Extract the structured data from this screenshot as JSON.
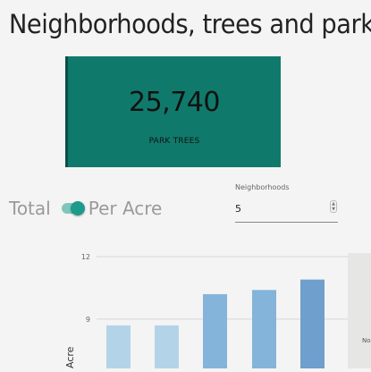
{
  "page": {
    "title": "Neighborhoods, trees and parks"
  },
  "kpi": {
    "value": "25,740",
    "label": "PARK TREES",
    "background_color": "#0f7a6b"
  },
  "toggle": {
    "left_label": "Total",
    "right_label": "Per Acre",
    "state": "Per Acre",
    "accent_color": "#1e9a8a"
  },
  "neighborhoods_select": {
    "label": "Neighborhoods",
    "value": "5",
    "stepper_icon": "up-down-arrows-icon"
  },
  "map": {
    "label": "Nor"
  },
  "chart_data": {
    "type": "bar",
    "ylabel": "Acre",
    "y_ticks": [
      12,
      9
    ],
    "ylim": [
      6.5,
      12.5
    ],
    "grid": true,
    "values": [
      8.7,
      8.7,
      10.2,
      10.4,
      10.9
    ],
    "colors": [
      "#b3d4e8",
      "#b3d4e8",
      "#84b4d9",
      "#84b4d9",
      "#6f9fcc"
    ]
  }
}
